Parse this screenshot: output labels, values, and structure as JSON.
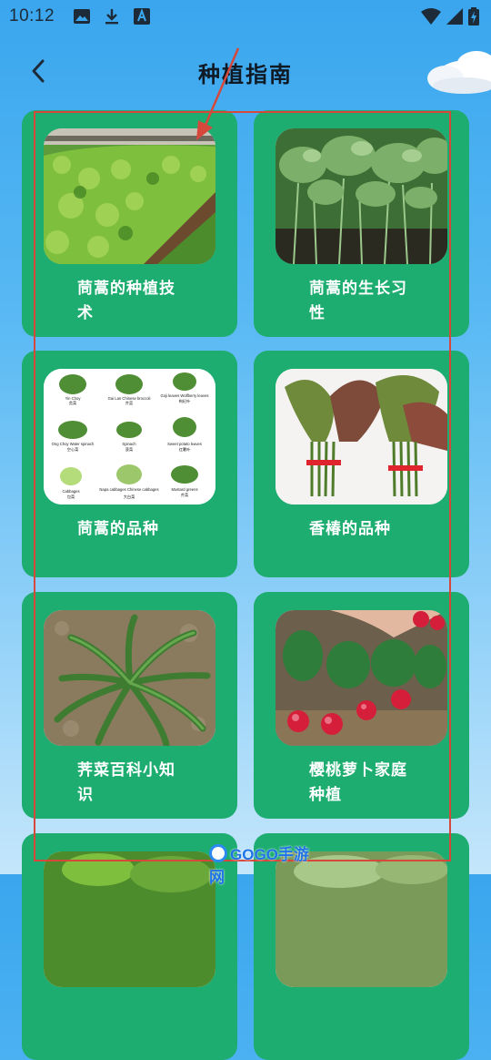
{
  "status_bar": {
    "time": "10:12",
    "left_icons": [
      "image-icon",
      "download-icon",
      "text-a-icon"
    ],
    "right_icons": [
      "wifi-icon",
      "signal-icon",
      "battery-icon"
    ]
  },
  "header": {
    "title": "种植指南",
    "back_icon": "chevron-left-icon"
  },
  "guide_items": [
    {
      "label": "茼蒿的种植技术",
      "image": "crop-field-photo"
    },
    {
      "label": "茼蒿的生长习性",
      "image": "leafy-greens-photo"
    },
    {
      "label": "茼蒿的品种",
      "image": "vegetable-chart-photo"
    },
    {
      "label": "香椿的品种",
      "image": "toon-bundles-photo"
    },
    {
      "label": "荠菜百科小知识",
      "image": "shepherds-purse-photo"
    },
    {
      "label": "樱桃萝卜家庭种植",
      "image": "cherry-radish-photo"
    },
    {
      "label": "",
      "image": "greens-photo"
    },
    {
      "label": "",
      "image": "greens-photo"
    }
  ],
  "chart_labels": [
    {
      "en": "Yin Choy",
      "zh": "苋菜"
    },
    {
      "en": "Gai Lan Chinese broccoli",
      "zh": "芥蓝"
    },
    {
      "en": "Goji leaves Wolfberry leaves",
      "zh": "枸杞叶"
    },
    {
      "en": "Ong Choy Water spinach",
      "zh": "空心菜"
    },
    {
      "en": "Spinach",
      "zh": "菠菜"
    },
    {
      "en": "Sweet potato leaves",
      "zh": "红薯叶"
    },
    {
      "en": "Cabbages",
      "zh": "包菜"
    },
    {
      "en": "Napa cabbages Chinese cabbages",
      "zh": "大白菜"
    },
    {
      "en": "Mustard greens",
      "zh": "芥菜"
    }
  ],
  "watermark": {
    "text": "GOGO手游网"
  },
  "colors": {
    "card": "#1ead70",
    "highlight": "#d6483c",
    "title": "#0f1a24"
  }
}
